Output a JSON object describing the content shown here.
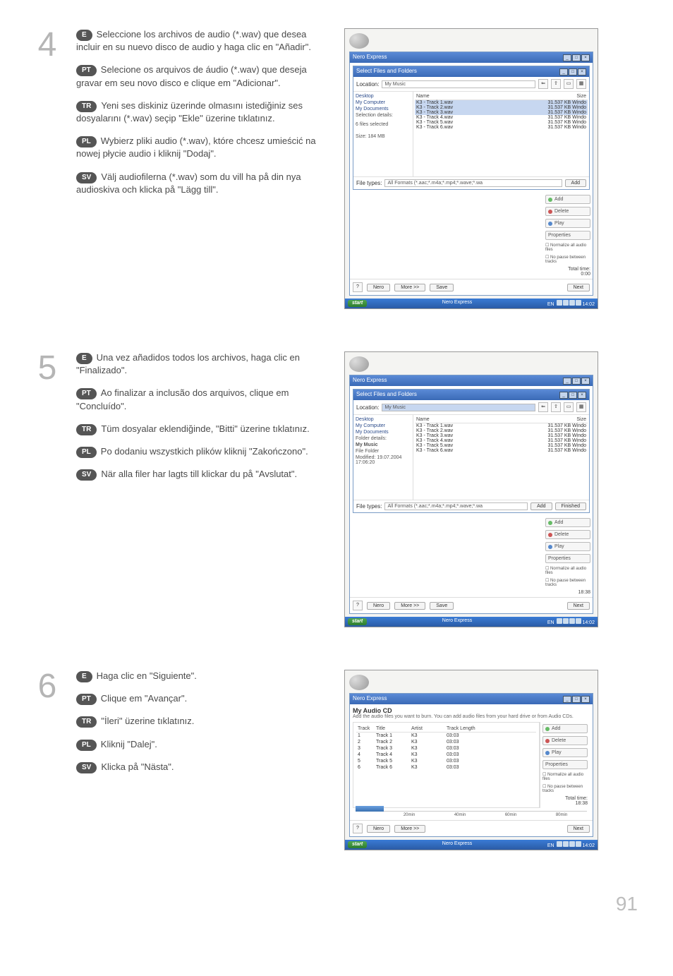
{
  "page_number": "91",
  "steps": [
    {
      "number": "4",
      "langs": [
        {
          "code": "E",
          "text": "Seleccione los archivos de audio (*.wav) que desea incluir en su nuevo disco de audio y haga clic en \"Añadir\"."
        },
        {
          "code": "PT",
          "text": "Selecione os arquivos de áudio (*.wav) que deseja gravar em seu novo disco e clique em \"Adicionar\"."
        },
        {
          "code": "TR",
          "text": "Yeni ses diskiniz üzerinde olmasını istediğiniz ses dosyalarını (*.wav) seçip \"Ekle\" üzerine tıklatınız."
        },
        {
          "code": "PL",
          "text": "Wybierz pliki audio (*.wav), które chcesz umieścić na nowej płycie audio i kliknij \"Dodaj\"."
        },
        {
          "code": "SV",
          "text": "Välj audiofilerna (*.wav) som du vill ha på din nya audioskiva och klicka på \"Lägg till\"."
        }
      ],
      "screenshot": {
        "app": "Nero Express",
        "dialog_title": "Select Files and Folders",
        "location_label": "Location:",
        "location_value": "My Music",
        "tree": [
          "Desktop",
          "My Computer",
          "My Documents"
        ],
        "selection_details_label": "Selection details:",
        "selection_info": "6 files selected",
        "size_label": "Size:",
        "size_value": "184 MB",
        "col_name": "Name",
        "col_size": "Size",
        "files": [
          {
            "name": "K3 - Track 1.wav",
            "size": "31.537 KB",
            "type": "Windo",
            "sel": true
          },
          {
            "name": "K3 - Track 2.wav",
            "size": "31.537 KB",
            "type": "Windo",
            "sel": true
          },
          {
            "name": "K3 - Track 3.wav",
            "size": "31.537 KB",
            "type": "Windo",
            "sel": true
          },
          {
            "name": "K3 - Track 4.wav",
            "size": "31.537 KB",
            "type": "Windo",
            "sel": false
          },
          {
            "name": "K3 - Track 5.wav",
            "size": "31.537 KB",
            "type": "Windo",
            "sel": false
          },
          {
            "name": "K3 - Track 6.wav",
            "size": "31.537 KB",
            "type": "Windo",
            "sel": false
          }
        ],
        "right_buttons": [
          "Add",
          "Delete",
          "Play",
          "Properties"
        ],
        "checks": [
          "Normalize all audio files",
          "No pause between tracks"
        ],
        "total_time_label": "Total time:",
        "total_time_value": "0:00",
        "filetypes_label": "File types:",
        "filetypes_value": "All Formats (*.aac;*.m4a;*.mp4;*.wave;*.wa",
        "add_btn": "Add",
        "footer": {
          "nero": "Nero",
          "more": "More >>",
          "save": "Save",
          "next": "Next"
        },
        "taskbar": {
          "start": "start",
          "task": "Nero Express",
          "lang": "EN",
          "clock": "14:02"
        }
      }
    },
    {
      "number": "5",
      "langs": [
        {
          "code": "E",
          "text": "Una vez añadidos todos los archivos, haga clic en \"Finalizado\"."
        },
        {
          "code": "PT",
          "text": "Ao finalizar a inclusão dos arquivos, clique em \"Concluído\"."
        },
        {
          "code": "TR",
          "text": "Tüm dosyalar eklendiğinde, \"Bitti\" üzerine tıklatınız."
        },
        {
          "code": "PL",
          "text": "Po dodaniu wszystkich plików kliknij \"Zakończono\"."
        },
        {
          "code": "SV",
          "text": "När alla filer har lagts till klickar du på \"Avslutat\"."
        }
      ],
      "screenshot": {
        "app": "Nero Express",
        "dialog_title": "Select Files and Folders",
        "location_label": "Location:",
        "location_value": "My Music",
        "tree": [
          "Desktop",
          "My Computer",
          "My Documents"
        ],
        "folder_details_label": "Folder details:",
        "folder_name": "My Music",
        "type_line": "File Folder",
        "modified_label": "Modified:",
        "modified_value": "19.07.2004 17:06:20",
        "col_name": "Name",
        "col_size": "Size",
        "files": [
          {
            "name": "K3 - Track 1.wav",
            "size": "31.537 KB",
            "type": "Windo"
          },
          {
            "name": "K3 - Track 2.wav",
            "size": "31.537 KB",
            "type": "Windo"
          },
          {
            "name": "K3 - Track 3.wav",
            "size": "31.537 KB",
            "type": "Windo"
          },
          {
            "name": "K3 - Track 4.wav",
            "size": "31.537 KB",
            "type": "Windo"
          },
          {
            "name": "K3 - Track 5.wav",
            "size": "31.537 KB",
            "type": "Windo"
          },
          {
            "name": "K3 - Track 6.wav",
            "size": "31.537 KB",
            "type": "Windo"
          }
        ],
        "right_buttons": [
          "Add",
          "Delete",
          "Play",
          "Properties"
        ],
        "checks": [
          "Normalize all audio files",
          "No pause between tracks"
        ],
        "total_time_value": "18:38",
        "filetypes_label": "File types:",
        "filetypes_value": "All Formats (*.aac;*.m4a;*.mp4;*.wave;*.wa",
        "add_btn": "Add",
        "finished_btn": "Finished",
        "footer": {
          "nero": "Nero",
          "more": "More >>",
          "save": "Save",
          "next": "Next"
        },
        "taskbar": {
          "start": "start",
          "task": "Nero Express",
          "lang": "EN",
          "clock": "14:02"
        }
      }
    },
    {
      "number": "6",
      "langs": [
        {
          "code": "E",
          "text": "Haga clic en \"Siguiente\"."
        },
        {
          "code": "PT",
          "text": "Clique em \"Avançar\"."
        },
        {
          "code": "TR",
          "text": "\"İleri\" üzerine tıklatınız."
        },
        {
          "code": "PL",
          "text": "Kliknij \"Dalej\"."
        },
        {
          "code": "SV",
          "text": "Klicka på \"Nästa\"."
        }
      ],
      "screenshot": {
        "app": "Nero Express",
        "heading": "My Audio CD",
        "subtext": "Add the audio files you want to burn. You can add audio files from your hard drive or from Audio CDs.",
        "cols": [
          "Track",
          "Title",
          "Artist",
          "Track Length"
        ],
        "tracks": [
          {
            "n": "1",
            "title": "Track 1",
            "artist": "K3",
            "len": "03:03"
          },
          {
            "n": "2",
            "title": "Track 2",
            "artist": "K3",
            "len": "03:03"
          },
          {
            "n": "3",
            "title": "Track 3",
            "artist": "K3",
            "len": "03:03"
          },
          {
            "n": "4",
            "title": "Track 4",
            "artist": "K3",
            "len": "03:03"
          },
          {
            "n": "5",
            "title": "Track 5",
            "artist": "K3",
            "len": "03:03"
          },
          {
            "n": "6",
            "title": "Track 6",
            "artist": "K3",
            "len": "03:03"
          }
        ],
        "right_buttons": [
          "Add",
          "Delete",
          "Play",
          "Properties"
        ],
        "checks": [
          "Normalize all audio files",
          "No pause between tracks"
        ],
        "total_time_label": "Total time:",
        "total_time_value": "18:38",
        "timeline": [
          "20min",
          "40min",
          "60min",
          "80min"
        ],
        "footer": {
          "nero": "Nero",
          "more": "More >>",
          "next": "Next"
        },
        "taskbar": {
          "start": "start",
          "task": "Nero Express",
          "lang": "EN",
          "clock": "14:02"
        }
      }
    }
  ]
}
